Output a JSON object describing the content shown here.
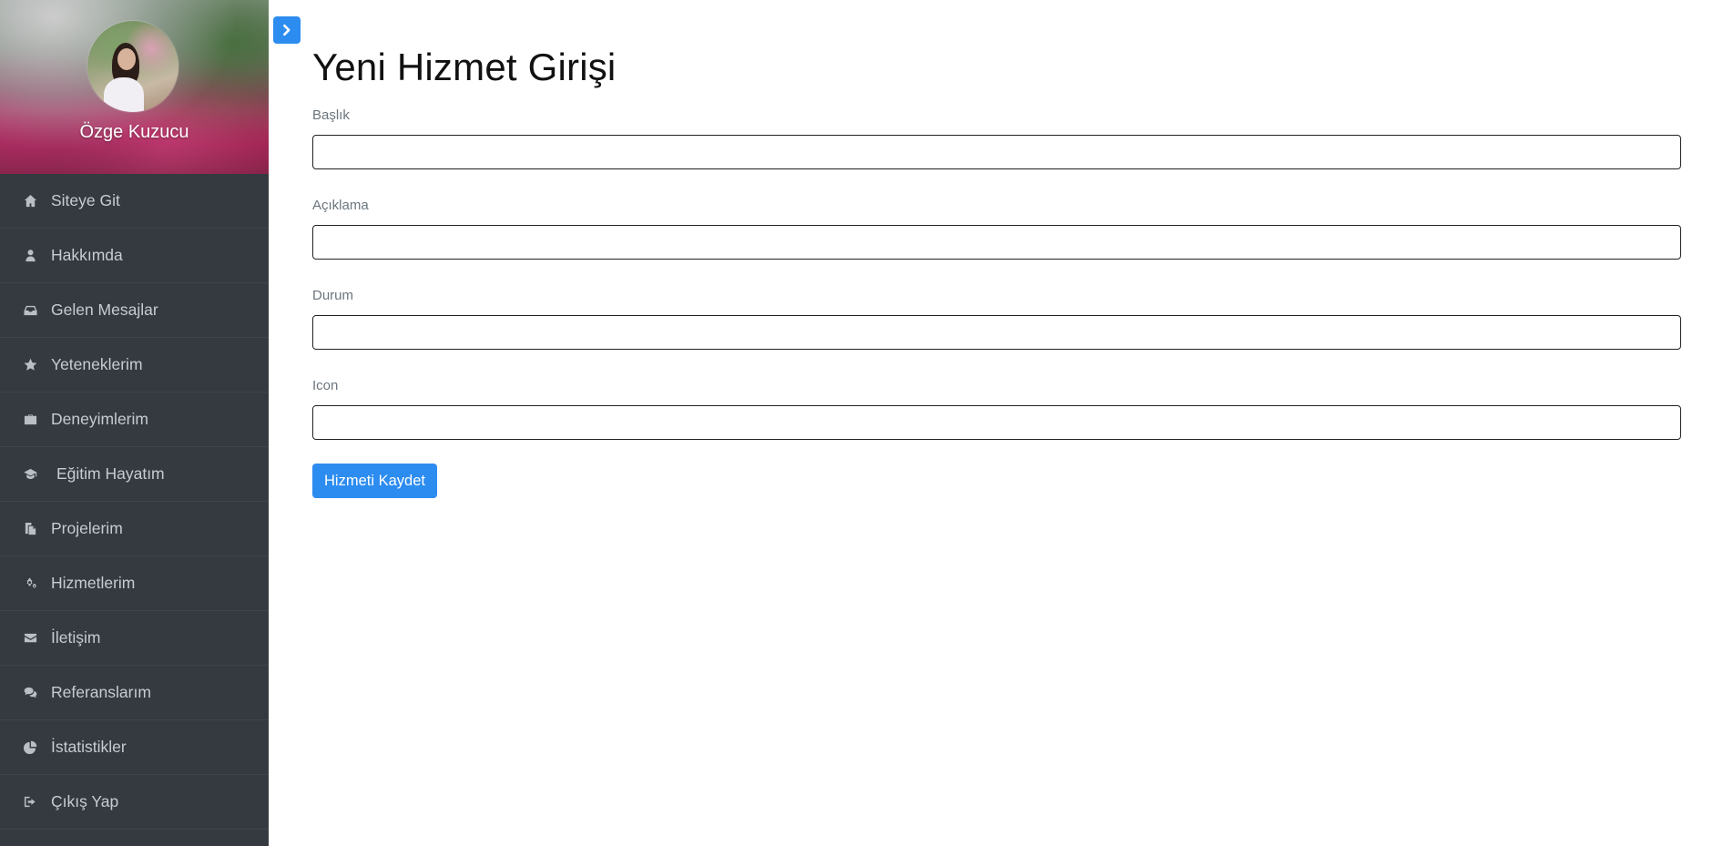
{
  "sidebar": {
    "profile_name": "Özge Kuzucu",
    "items": [
      {
        "label": "Siteye Git",
        "icon": "home-icon"
      },
      {
        "label": "Hakkımda",
        "icon": "user-icon"
      },
      {
        "label": "Gelen Mesajlar",
        "icon": "inbox-icon"
      },
      {
        "label": "Yeteneklerim",
        "icon": "star-icon"
      },
      {
        "label": "Deneyimlerim",
        "icon": "briefcase-icon"
      },
      {
        "label": "Eğitim Hayatım",
        "icon": "graduation-cap-icon"
      },
      {
        "label": "Projelerim",
        "icon": "files-icon"
      },
      {
        "label": "Hizmetlerim",
        "icon": "gears-icon"
      },
      {
        "label": "İletişim",
        "icon": "envelope-icon"
      },
      {
        "label": "Referanslarım",
        "icon": "comments-icon"
      },
      {
        "label": "İstatistikler",
        "icon": "pie-chart-icon"
      },
      {
        "label": "Çıkış Yap",
        "icon": "sign-out-icon"
      }
    ]
  },
  "toggle": {
    "icon": "chevron-right-icon",
    "color": "#2d8cf0"
  },
  "main": {
    "title": "Yeni Hizmet Girişi",
    "fields": {
      "title_label": "Başlık",
      "title_value": "",
      "description_label": "Açıklama",
      "description_value": "",
      "status_label": "Durum",
      "status_value": "",
      "icon_label": "Icon",
      "icon_value": ""
    },
    "save_label": "Hizmeti Kaydet"
  },
  "colors": {
    "sidebar_bg": "#343a40",
    "accent": "#2d8cf0"
  }
}
